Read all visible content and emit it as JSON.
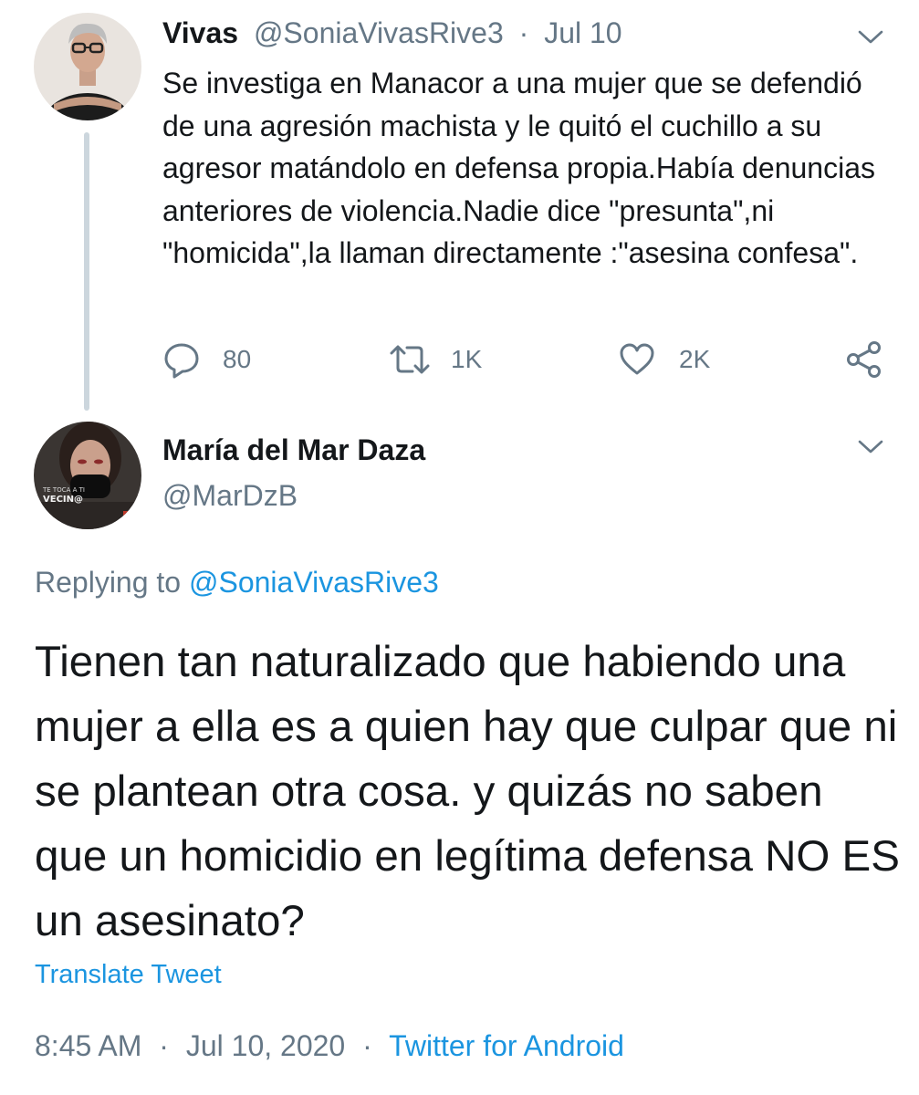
{
  "parent_tweet": {
    "author_name": "Vivas",
    "author_handle": "@SoniaVivasRive3",
    "separator": "·",
    "date": "Jul 10",
    "text": "Se investiga en Manacor a una mujer que se defendió de una agresión machista y le quitó el cuchillo a su agresor matándolo en defensa propia.Había denuncias anteriores de violencia.Nadie dice \"presunta\",ni \"homicida\",la llaman directamente :\"asesina confesa\".",
    "reply_count": "80",
    "retweet_count": "1K",
    "like_count": "2K"
  },
  "main_tweet": {
    "author_name": "María del Mar Daza",
    "author_handle": "@MarDzB",
    "replying_to_label": "Replying to",
    "replying_to_handle": "@SoniaVivasRive3",
    "text": "Tienen tan naturalizado que habiendo una mujer a ella es a quien hay que culpar que ni se plantean otra cosa. y quizás no saben que un homicidio  en legítima defensa NO ES un asesinato?",
    "translate_label": "Translate Tweet",
    "time": "8:45 AM",
    "separator": "·",
    "date": "Jul 10, 2020",
    "source": "Twitter for Android"
  },
  "avatar_text": {
    "line1": "TE TOCA A TI",
    "line2": "VECIN@"
  },
  "icons": [
    "reply-icon",
    "retweet-icon",
    "like-icon",
    "share-icon",
    "chevron-down-icon"
  ],
  "colors": {
    "text": "#14171a",
    "muted": "#657786",
    "link": "#1b95e0",
    "thread_line": "#ccd6dd"
  }
}
